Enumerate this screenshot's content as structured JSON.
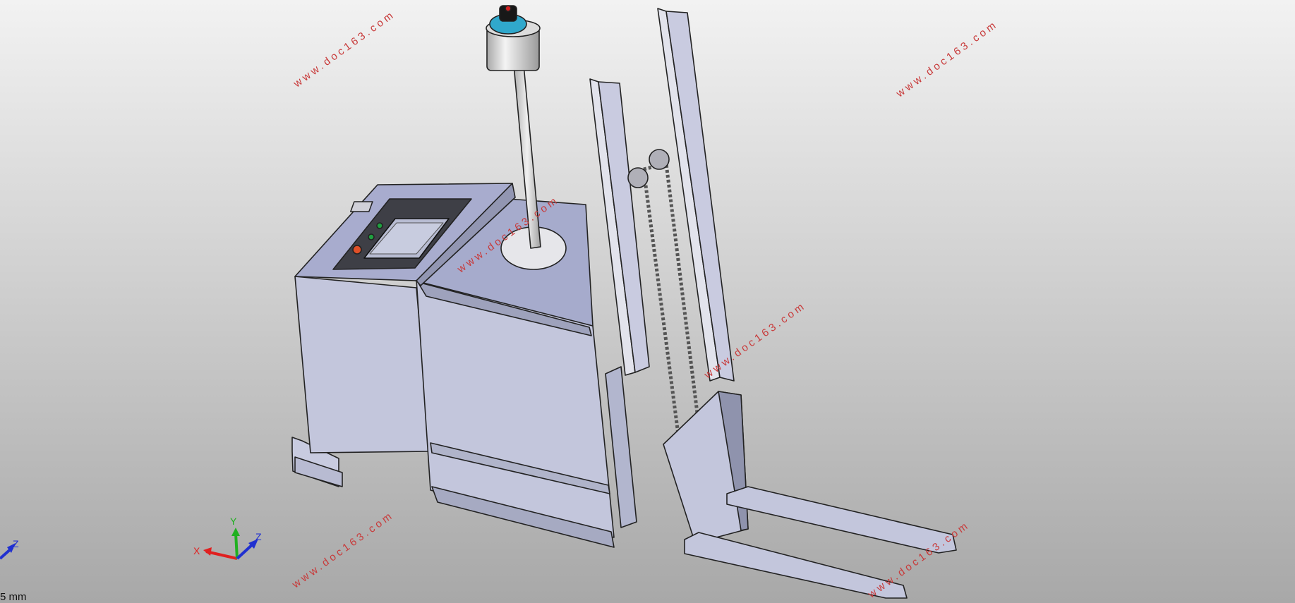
{
  "watermark": "www.doc163.com",
  "scale": {
    "label": "5 mm"
  },
  "triad": {
    "x_label": "X",
    "y_label": "Y",
    "z_label": "Z"
  },
  "corner_triad": {
    "z_label": "Z"
  },
  "colors": {
    "background_top": "#f2f2f2",
    "background_bottom": "#a8a8a8",
    "body": "#c3c6dc",
    "body_dark": "#8a8ea8",
    "edge": "#222222",
    "watermark": "#c83a3a",
    "x_axis": "#e02020",
    "y_axis": "#20b020",
    "z_axis": "#2030d0",
    "sensor": "#30a8cc"
  }
}
